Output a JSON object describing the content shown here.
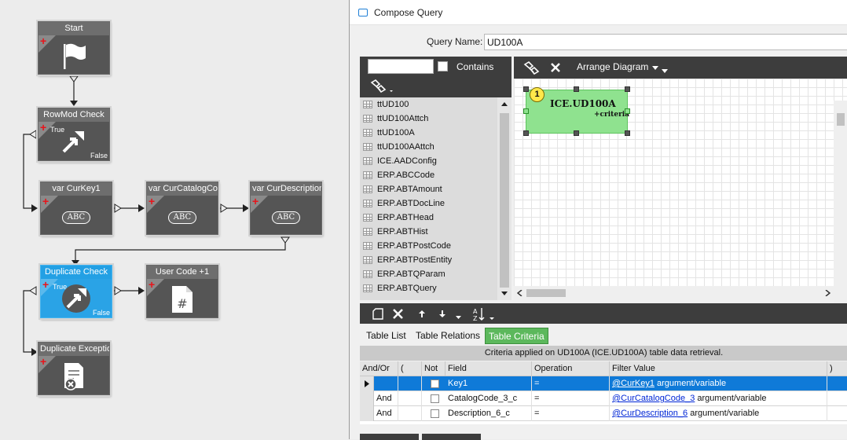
{
  "workflow": {
    "nodes": [
      {
        "id": "start",
        "title": "Start"
      },
      {
        "id": "rowmod",
        "title": "RowMod Check",
        "true_label": "True",
        "false_label": "False"
      },
      {
        "id": "curkey1",
        "title": "var CurKey1",
        "value": "ABC"
      },
      {
        "id": "curcatalog",
        "title": "var CurCatalogCod",
        "value": "ABC"
      },
      {
        "id": "curdesc",
        "title": "var CurDescription",
        "value": "ABC"
      },
      {
        "id": "dupcheck",
        "title": "Duplicate Check",
        "true_label": "True",
        "false_label": "False"
      },
      {
        "id": "usercode",
        "title": "User Code +1"
      },
      {
        "id": "dupexc",
        "title": "Duplicate Exceptio"
      }
    ]
  },
  "window": {
    "title": "Compose Query"
  },
  "query_name": {
    "label": "Query Name:",
    "value": "UD100A"
  },
  "table_search": {
    "value": "",
    "contains_label": "Contains"
  },
  "tables": [
    "ttUD100",
    "ttUD100Attch",
    "ttUD100A",
    "ttUD100AAttch",
    "ICE.AADConfig",
    "ERP.ABCCode",
    "ERP.ABTAmount",
    "ERP.ABTDocLine",
    "ERP.ABTHead",
    "ERP.ABTHist",
    "ERP.ABTPostCode",
    "ERP.ABTPostEntity",
    "ERP.ABTQParam",
    "ERP.ABTQuery"
  ],
  "diagram": {
    "arrange_label": "Arrange Diagram",
    "entity": {
      "badge": "1",
      "name": "ICE.UD100A",
      "criteria": "+criteria"
    }
  },
  "tabs": [
    "Table List",
    "Table Relations",
    "Table Criteria"
  ],
  "active_tab": "Table Criteria",
  "criteria": {
    "caption": "Criteria applied on UD100A (ICE.UD100A)  table data retrieval.",
    "columns": [
      "And/Or",
      "(",
      "Not",
      "Field",
      "Operation",
      "Filter Value",
      ")"
    ],
    "rows": [
      {
        "andor": "",
        "field": "Key1",
        "op": "=",
        "value": "@CurKey1",
        "suffix": "argument/variable"
      },
      {
        "andor": "And",
        "field": "CatalogCode_3_c",
        "op": "=",
        "value": "@CurCatalogCode_3",
        "suffix": "argument/variable"
      },
      {
        "andor": "And",
        "field": "Description_6_c",
        "op": "=",
        "value": "@CurDescription_6",
        "suffix": "argument/variable"
      }
    ]
  },
  "colors": {
    "accent_selected": "#0f7ad8",
    "active_tab": "#5cb85c",
    "entity_fill": "#8fe28f",
    "node_selected": "#2aa3e6"
  }
}
